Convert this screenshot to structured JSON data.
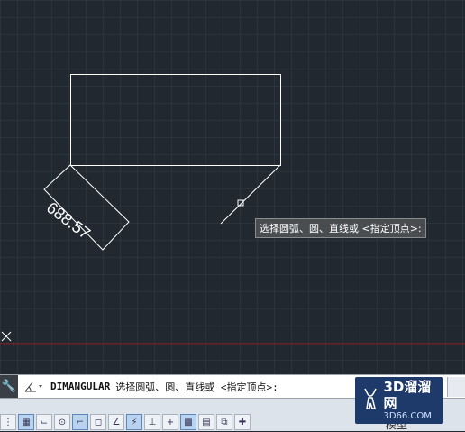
{
  "drawing": {
    "dimension_value": "688.57",
    "tooltip": "选择圆弧、圆、直线或 <指定顶点>:"
  },
  "command_line": {
    "command": "DIMANGULAR",
    "prompt": "选择圆弧、圆、直线或 <指定顶点>:"
  },
  "status_bar": {
    "model_label": "模型"
  },
  "watermark": {
    "brand": "3D溜溜网",
    "url": "3D66.COM"
  },
  "colors": {
    "background": "#212830",
    "lines": "#ffffff",
    "x_axis": "#8b1a1a"
  }
}
